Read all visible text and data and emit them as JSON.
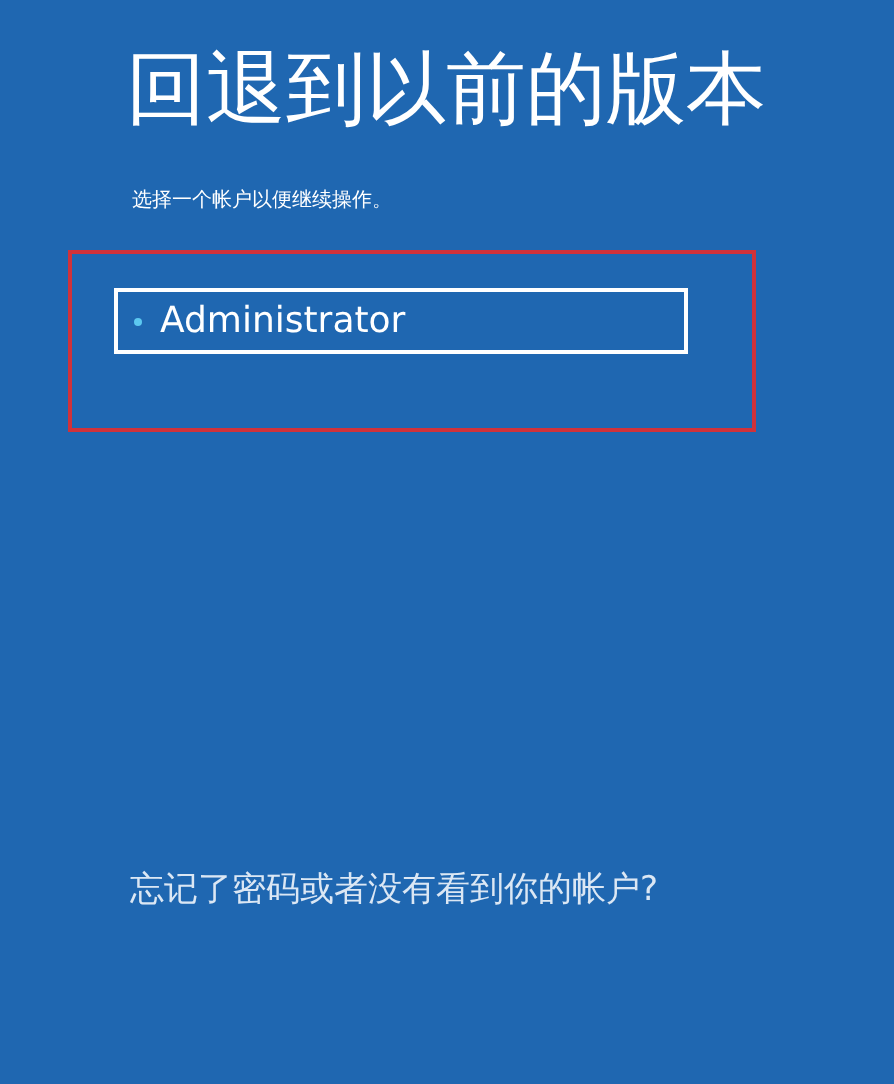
{
  "title": "回退到以前的版本",
  "instruction": "选择一个帐户以便继续操作。",
  "accounts": [
    {
      "name": "Administrator",
      "selected": true
    }
  ],
  "highlight": true,
  "forgot_link": "忘记了密码或者没有看到你的帐户?"
}
